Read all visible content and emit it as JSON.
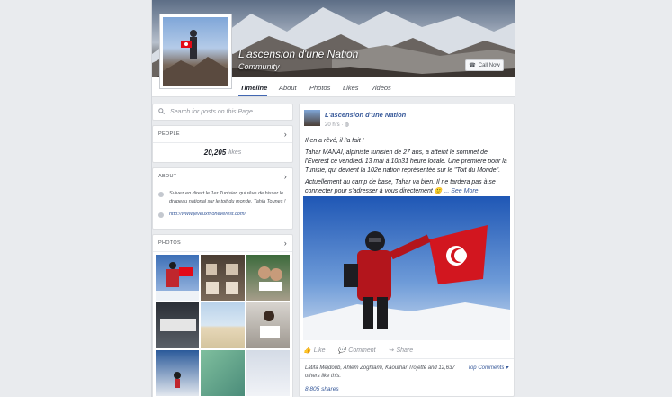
{
  "page": {
    "name": "L'ascension d'une Nation",
    "category": "Community",
    "call_button": "Call Now"
  },
  "tabs": [
    "Timeline",
    "About",
    "Photos",
    "Likes",
    "Videos"
  ],
  "search": {
    "placeholder": "Search for posts on this Page"
  },
  "people": {
    "header": "PEOPLE",
    "count": "20,205",
    "unit": "likes"
  },
  "about": {
    "header": "ABOUT",
    "description": "Suivez en direct le 1er Tunisien qui rêve de hisser le drapeau national sur le toit du monde. Tahia Tounes !",
    "website": "http://www.jeveuxmoneverest.com/"
  },
  "photos": {
    "header": "PHOTOS"
  },
  "post": {
    "author": "L'ascension d'une Nation",
    "time": "20 hrs",
    "line1": "Il en a rêvé, il l'a fait !",
    "line2": "Tahar MANAI, alpiniste tunisien de 27 ans, a atteint le sommet de l'Everest ce vendredi 13 mai à 10h31 heure locale. Une première pour la Tunisie, qui devient la 102e nation représentée sur le \"Toit du Monde\".",
    "line3": "Actuellement au camp de base, Tahar va bien. Il ne tardera pas à se connecter pour s'adresser à vous directement",
    "emoji": "🙂",
    "see_more": "... See More",
    "action_like": "Like",
    "action_comment": "Comment",
    "action_share": "Share",
    "likes_text": "Latifa Mejdoub, Ahlem Zoghlami, Kaouthar Trojette and 12,637 others like this.",
    "top_comments": "Top Comments ▾",
    "shares": "8,805 shares"
  },
  "colors": {
    "accent": "#4267b2",
    "link": "#365899",
    "flag_red": "#e30a17"
  }
}
